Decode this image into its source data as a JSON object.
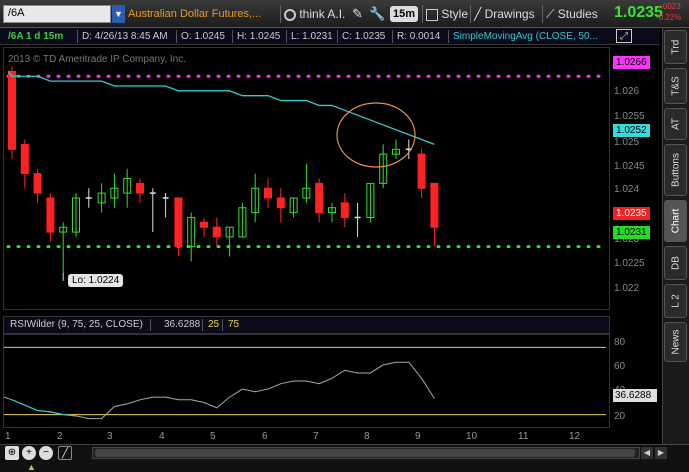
{
  "toolbar": {
    "symbol": "/6A",
    "description": "Australian Dollar Futures,...",
    "think_ai": "think A.I.",
    "timeframe": "15m",
    "style": "Style",
    "drawings": "Drawings",
    "studies": "Studies",
    "last_price": "1.0235",
    "change_abs": "-.0023",
    "change_pct": "-0.22%"
  },
  "infobar": {
    "period": "/6A 1 d 15m",
    "date": "D: 4/26/13 8:45 AM",
    "open": "O: 1.0245",
    "high": "H: 1.0245",
    "low": "L: 1.0231",
    "close": "C: 1.0235",
    "range": "R: 0.0014",
    "study": "SimpleMovingAvg (CLOSE, 50..."
  },
  "chart": {
    "copyright": "2013 © TD Ameritrade IP Company, Inc.",
    "lo_label": "Lo: 1.0224",
    "price_ticks": [
      "1.026",
      "1.0255",
      "1.025",
      "1.0245",
      "1.024",
      "1.0235",
      "1.023",
      "1.0225",
      "1.022"
    ],
    "tag_top": "1.0266",
    "tag_sma": "1.0252",
    "tag_close": "1.0235",
    "tag_bottom": "1.0231",
    "colors": {
      "up": "#33dd33",
      "down": "#ff2222",
      "sma": "#33cccc",
      "magenta_dots": "#ff33ff",
      "green_dots": "#22ee22"
    }
  },
  "rsi": {
    "label": "RSIWilder (9, 75, 25, CLOSE)",
    "value": "36.6288",
    "oversold": "25",
    "overbought": "75",
    "ticks": [
      "80",
      "60",
      "40",
      "20"
    ],
    "tag": "36.6288"
  },
  "xaxis": {
    "ticks": [
      "1",
      "2",
      "3",
      "4",
      "5",
      "6",
      "7",
      "8",
      "9",
      "10",
      "11",
      "12"
    ]
  },
  "sidetabs": [
    "Trd",
    "T&S",
    "AT",
    "Buttons",
    "Chart",
    "DB",
    "L 2",
    "News"
  ],
  "chart_data": {
    "type": "candlestick",
    "candles": [
      {
        "o": 1.0267,
        "h": 1.0268,
        "c": 1.0251,
        "l": 1.0249
      },
      {
        "o": 1.0252,
        "h": 1.0253,
        "c": 1.0246,
        "l": 1.0243
      },
      {
        "o": 1.0246,
        "h": 1.0247,
        "c": 1.0242,
        "l": 1.024
      },
      {
        "o": 1.0241,
        "h": 1.0242,
        "c": 1.0234,
        "l": 1.0232
      },
      {
        "o": 1.0234,
        "h": 1.0236,
        "c": 1.0235,
        "l": 1.0224
      },
      {
        "o": 1.0234,
        "h": 1.0242,
        "c": 1.0241,
        "l": 1.0233
      },
      {
        "o": 1.0241,
        "h": 1.0243,
        "c": 1.0241,
        "l": 1.0239
      },
      {
        "o": 1.024,
        "h": 1.0244,
        "c": 1.0242,
        "l": 1.0238
      },
      {
        "o": 1.0241,
        "h": 1.0246,
        "c": 1.0243,
        "l": 1.0239
      },
      {
        "o": 1.0242,
        "h": 1.0247,
        "c": 1.0245,
        "l": 1.0239
      },
      {
        "o": 1.0244,
        "h": 1.0245,
        "c": 1.0242,
        "l": 1.024
      },
      {
        "o": 1.0242,
        "h": 1.0243,
        "c": 1.0242,
        "l": 1.0234
      },
      {
        "o": 1.0241,
        "h": 1.0242,
        "c": 1.0241,
        "l": 1.0237
      },
      {
        "o": 1.0241,
        "h": 1.0241,
        "c": 1.0231,
        "l": 1.0229
      },
      {
        "o": 1.0231,
        "h": 1.0238,
        "c": 1.0237,
        "l": 1.0228
      },
      {
        "o": 1.0236,
        "h": 1.0237,
        "c": 1.0235,
        "l": 1.0233
      },
      {
        "o": 1.0235,
        "h": 1.0237,
        "c": 1.0233,
        "l": 1.0231
      },
      {
        "o": 1.0233,
        "h": 1.0235,
        "c": 1.0235,
        "l": 1.0229
      },
      {
        "o": 1.0233,
        "h": 1.024,
        "c": 1.0239,
        "l": 1.0233
      },
      {
        "o": 1.0238,
        "h": 1.0246,
        "c": 1.0243,
        "l": 1.0236
      },
      {
        "o": 1.0243,
        "h": 1.0245,
        "c": 1.0241,
        "l": 1.0239
      },
      {
        "o": 1.0241,
        "h": 1.0243,
        "c": 1.0239,
        "l": 1.0236
      },
      {
        "o": 1.0238,
        "h": 1.0241,
        "c": 1.0241,
        "l": 1.0237
      },
      {
        "o": 1.0241,
        "h": 1.0248,
        "c": 1.0243,
        "l": 1.024
      },
      {
        "o": 1.0244,
        "h": 1.0245,
        "c": 1.0238,
        "l": 1.0236
      },
      {
        "o": 1.0238,
        "h": 1.024,
        "c": 1.0239,
        "l": 1.0236
      },
      {
        "o": 1.024,
        "h": 1.0242,
        "c": 1.0237,
        "l": 1.0235
      },
      {
        "o": 1.0237,
        "h": 1.024,
        "c": 1.0237,
        "l": 1.0233
      },
      {
        "o": 1.0237,
        "h": 1.0244,
        "c": 1.0244,
        "l": 1.0236
      },
      {
        "o": 1.0244,
        "h": 1.0252,
        "c": 1.025,
        "l": 1.0243
      },
      {
        "o": 1.025,
        "h": 1.0253,
        "c": 1.0251,
        "l": 1.0249
      },
      {
        "o": 1.0251,
        "h": 1.0253,
        "c": 1.0251,
        "l": 1.0249
      },
      {
        "o": 1.025,
        "h": 1.0251,
        "c": 1.0243,
        "l": 1.0241
      },
      {
        "o": 1.0244,
        "h": 1.0244,
        "c": 1.0235,
        "l": 1.0231
      }
    ],
    "sma": [
      1.0266,
      1.0266,
      1.0266,
      1.0265,
      1.0265,
      1.0265,
      1.0265,
      1.0265,
      1.0264,
      1.0264,
      1.0264,
      1.0264,
      1.0264,
      1.0263,
      1.0263,
      1.0263,
      1.0263,
      1.0263,
      1.0262,
      1.0262,
      1.0262,
      1.0261,
      1.0261,
      1.0261,
      1.026,
      1.026,
      1.0259,
      1.0258,
      1.0257,
      1.0256,
      1.0255,
      1.0254,
      1.0253,
      1.0252
    ],
    "rsi_values": [
      36,
      32,
      28,
      27,
      25,
      24,
      22,
      22,
      31,
      33,
      36,
      38,
      38,
      36,
      36,
      34,
      30,
      38,
      44,
      42,
      44,
      48,
      50,
      50,
      48,
      52,
      58,
      56,
      56,
      62,
      64,
      64,
      52,
      37
    ],
    "price_ylim": [
      1.0218,
      1.0272
    ],
    "rsi_ylim": [
      15,
      85
    ]
  }
}
